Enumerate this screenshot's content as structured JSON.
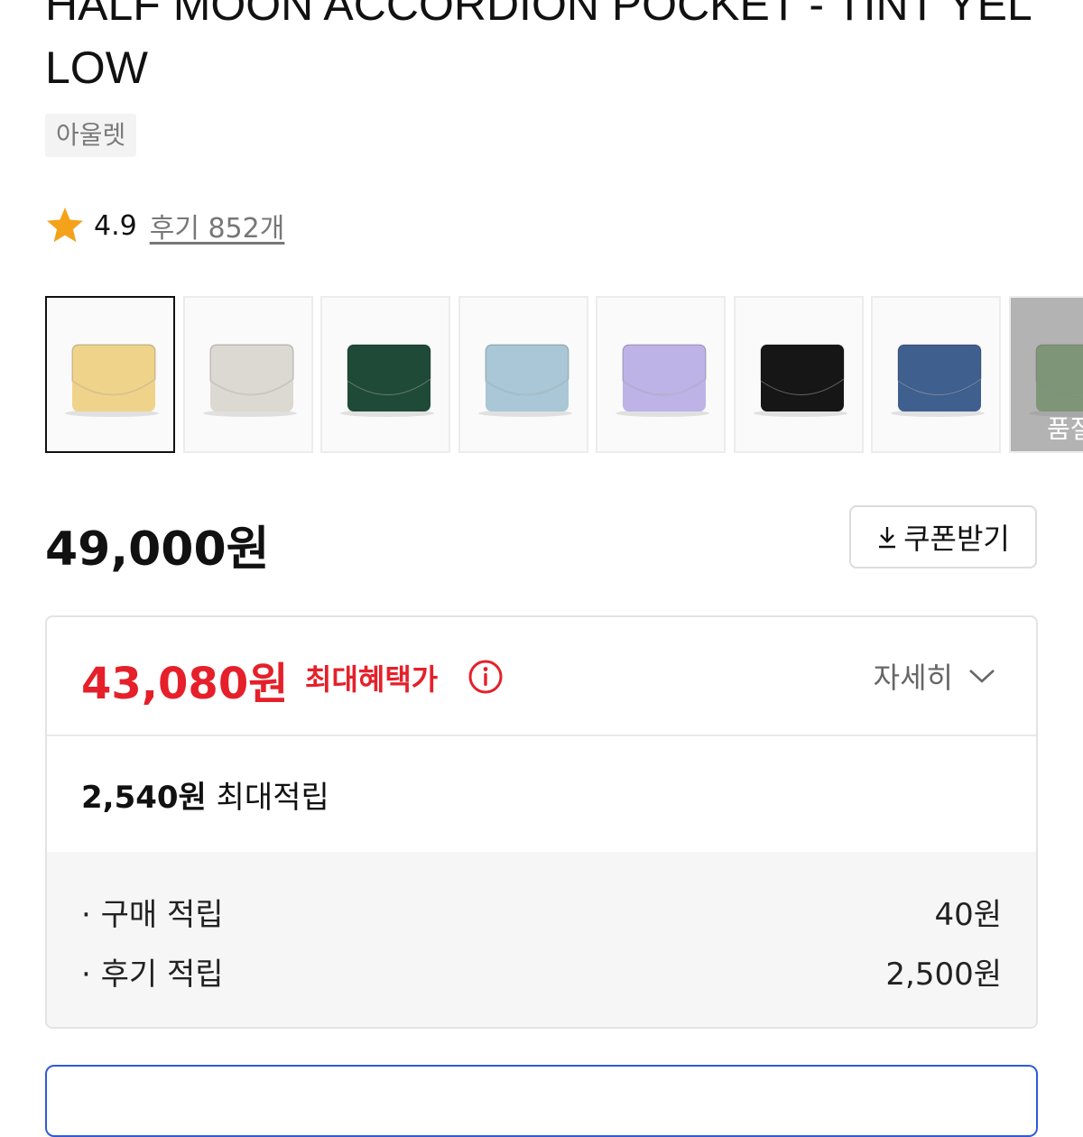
{
  "product": {
    "title": "HALF MOON ACCORDION POCKET - TINT YELLOW",
    "tag": "아울렛",
    "rating": "4.9",
    "reviews_label": "후기 852개"
  },
  "thumbnails": [
    {
      "color": "#f0d38a",
      "selected": true
    },
    {
      "color": "#dcd8d2",
      "selected": false
    },
    {
      "color": "#1f4a38",
      "selected": false
    },
    {
      "color": "#a9c7d6",
      "selected": false
    },
    {
      "color": "#bdb3e6",
      "selected": false
    },
    {
      "color": "#161616",
      "selected": false
    },
    {
      "color": "#3f5f8e",
      "selected": false
    },
    {
      "color": "#86b876",
      "selected": false,
      "overlay_label": "품절"
    }
  ],
  "pricing": {
    "price": "49,000원",
    "coupon_label": "쿠폰받기"
  },
  "benefit": {
    "max_price": "43,080원",
    "max_label": "최대혜택가",
    "detail_label": "자세히",
    "points_total": "2,540원",
    "points_label": "최대적립",
    "rows": [
      {
        "label": "· 구매 적립",
        "value": "40원"
      },
      {
        "label": "· 후기 적립",
        "value": "2,500원"
      }
    ]
  },
  "colors": {
    "accent_red": "#e5202a",
    "star": "#f5a21b",
    "button_blue": "#2f5bd6"
  },
  "icons": [
    "star-icon",
    "download-icon",
    "info-icon",
    "chevron-down-icon"
  ]
}
